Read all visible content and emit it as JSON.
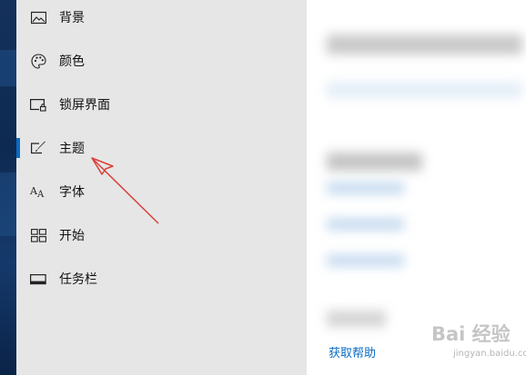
{
  "nav": {
    "items": [
      {
        "label": "背景",
        "icon": "picture-icon"
      },
      {
        "label": "颜色",
        "icon": "palette-icon"
      },
      {
        "label": "锁屏界面",
        "icon": "lock-screen-icon"
      },
      {
        "label": "主题",
        "icon": "theme-brush-icon",
        "selected": true
      },
      {
        "label": "字体",
        "icon": "font-icon"
      },
      {
        "label": "开始",
        "icon": "start-tiles-icon"
      },
      {
        "label": "任务栏",
        "icon": "taskbar-icon"
      }
    ]
  },
  "content": {
    "help_link": "获取帮助"
  },
  "watermark": {
    "text": "Bai 经验",
    "sub": "jingyan.baidu.com"
  },
  "colors": {
    "accent": "#0a6cc4",
    "annotation_arrow": "#d9403a",
    "sidebar_bg": "#e6e6e6"
  }
}
